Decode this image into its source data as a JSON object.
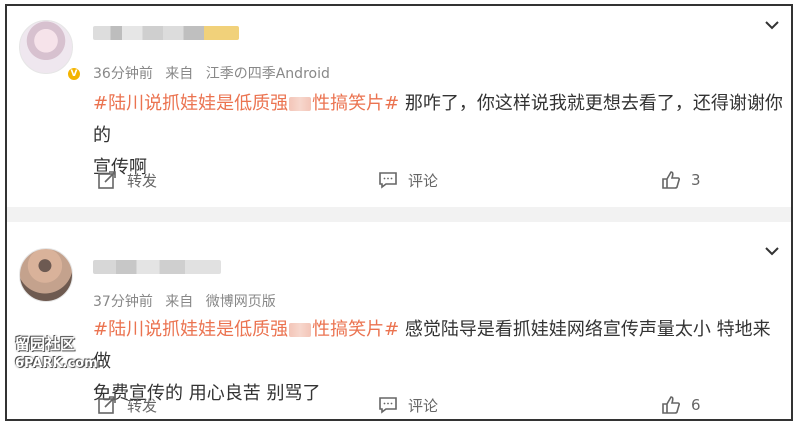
{
  "posts": [
    {
      "time": "36分钟前",
      "source_prefix": "来自",
      "source": "江季の四季Android",
      "topic_prefix": "#陆川说抓娃娃是低质强",
      "topic_suffix": "性搞笑片#",
      "body_line1": "那咋了，你这样说我就更想去看了，还得谢谢你的",
      "body_line2": "宣传啊",
      "forward_label": "转发",
      "comment_label": "评论",
      "like_count": "3"
    },
    {
      "time": "37分钟前",
      "source_prefix": "来自",
      "source": "微博网页版",
      "topic_prefix": "#陆川说抓娃娃是低质强",
      "topic_suffix": "性搞笑片#",
      "body_line1": " 感觉陆导是看抓娃娃网络宣传声量太小 特地来做",
      "body_line2": "免费宣传的 用心良苦 别骂了",
      "forward_label": "转发",
      "comment_label": "评论",
      "like_count": "6"
    }
  ],
  "watermark": {
    "line1": "留园社区",
    "line2": "6PARK.com"
  },
  "icons": {
    "expand": "chevron-down-icon",
    "forward": "forward-icon",
    "comment": "comment-icon",
    "like": "like-icon",
    "verified": "verified-badge-icon"
  },
  "colors": {
    "topic": "#eb7350",
    "meta": "#888888",
    "verified": "#f4b400"
  }
}
